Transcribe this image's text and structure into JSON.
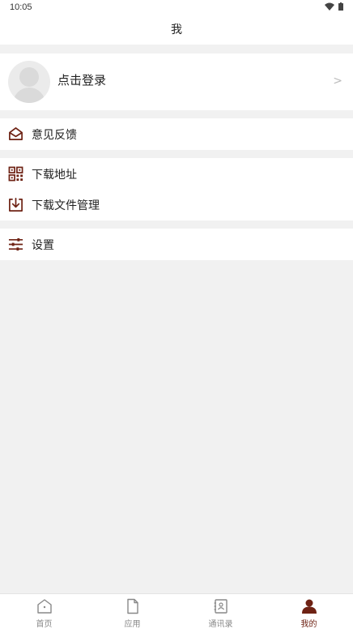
{
  "status_bar": {
    "time": "10:05"
  },
  "header": {
    "title": "我"
  },
  "profile": {
    "login_label": "点击登录"
  },
  "menu": {
    "feedback": "意见反馈",
    "download_address": "下载地址",
    "download_manager": "下载文件管理",
    "settings": "设置"
  },
  "tabs": [
    {
      "label": "首页",
      "icon": "home-icon"
    },
    {
      "label": "应用",
      "icon": "document-icon"
    },
    {
      "label": "通讯录",
      "icon": "contacts-icon"
    },
    {
      "label": "我的",
      "icon": "user-icon"
    }
  ],
  "colors": {
    "accent": "#6e2214",
    "background": "#f1f1f1",
    "inactive": "#888888"
  }
}
